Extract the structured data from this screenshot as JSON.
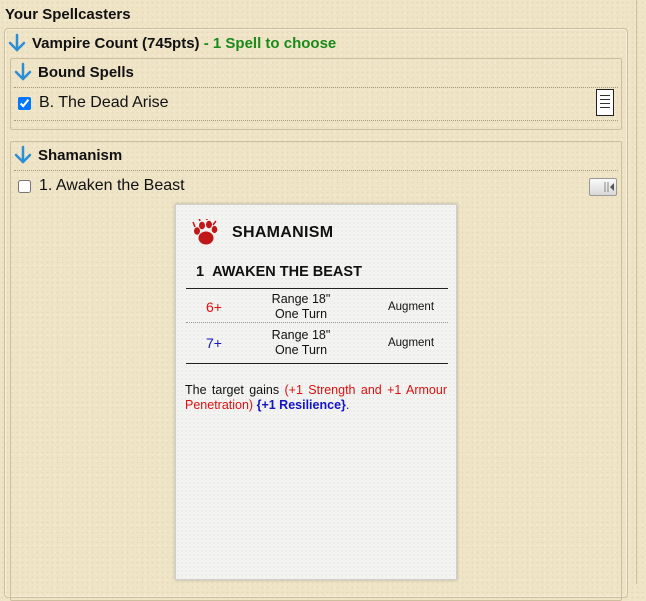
{
  "section_title": "Your Spellcasters",
  "caster": {
    "name": "Vampire Count (745pts)",
    "separator": " - ",
    "choose_text": "1 Spell to choose",
    "choose_color": "#1a8a1a"
  },
  "bound_spells": {
    "header": "Bound Spells",
    "spell": {
      "label": "B. The Dead Arise",
      "checked": true
    }
  },
  "shamanism": {
    "header": "Shamanism",
    "spell": {
      "label": "1. Awaken the Beast",
      "checked": false
    }
  },
  "card": {
    "lore": "SHAMANISM",
    "spell_number": "1",
    "spell_name": "AWAKEN THE BEAST",
    "rows": [
      {
        "casting_value": "6+",
        "color": "#dd1111",
        "range": "Range 18\"",
        "duration": "One Turn",
        "type": "Augment"
      },
      {
        "casting_value": "7+",
        "color": "#1414c8",
        "range": "Range 18\"",
        "duration": "One Turn",
        "type": "Augment"
      }
    ],
    "description": {
      "plain": "The target gains ",
      "red": "(+1 Strength and +1 Armour Penetration)",
      "space": " ",
      "blue": "{+1 Resilience}",
      "end": "."
    }
  },
  "icons": {
    "expand_arrow": "arrow-down-icon",
    "paw": "paw-icon",
    "doc": "document-icon",
    "toggle": "toggle-icon"
  },
  "colors": {
    "arrow": "#2b8fd6",
    "background": "#efe4c6",
    "red": "#dd1111",
    "blue": "#1414c8"
  }
}
